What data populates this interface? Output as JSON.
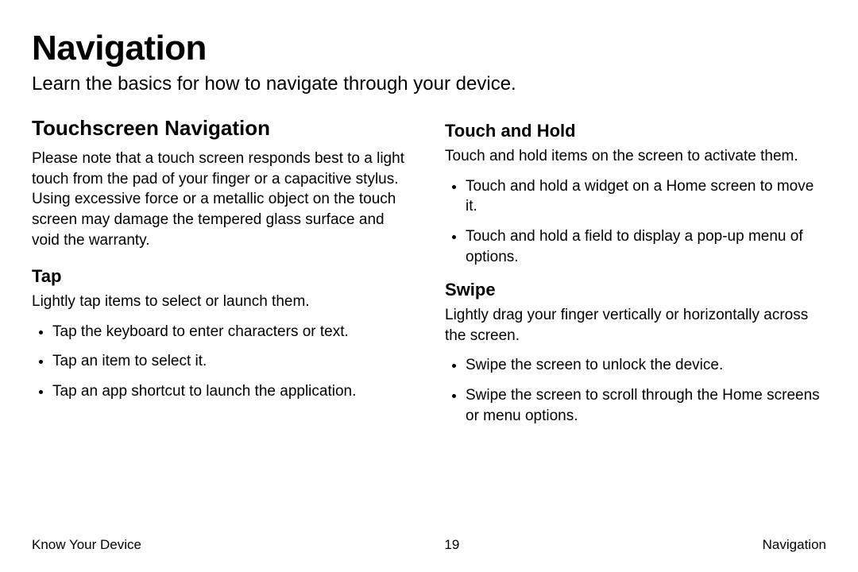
{
  "page": {
    "title": "Navigation",
    "subtitle": "Learn the basics for how to navigate through your device."
  },
  "left": {
    "heading": "Touchscreen Navigation",
    "paragraph": "Please note that a touch screen responds best to a light touch from the pad of your finger or a capacitive stylus. Using excessive force or a metallic object on the touch screen may damage the tempered glass surface and void the warranty.",
    "tap": {
      "heading": "Tap",
      "intro": "Lightly tap items to select or launch them.",
      "items": [
        "Tap the keyboard to enter characters or text.",
        "Tap an item to select it.",
        "Tap an app shortcut to launch the application."
      ]
    }
  },
  "right": {
    "touchhold": {
      "heading": "Touch and Hold",
      "intro": "Touch and hold items on the screen to activate them.",
      "items": [
        "Touch and hold a widget on a Home screen to move it.",
        "Touch and hold a field to display a pop-up menu of options."
      ]
    },
    "swipe": {
      "heading": "Swipe",
      "intro": "Lightly drag your finger vertically or horizontally across the screen.",
      "items": [
        "Swipe the screen to unlock the device.",
        "Swipe the screen to scroll through the Home screens or menu options."
      ]
    }
  },
  "footer": {
    "left": "Know Your Device",
    "center": "19",
    "right": "Navigation"
  }
}
